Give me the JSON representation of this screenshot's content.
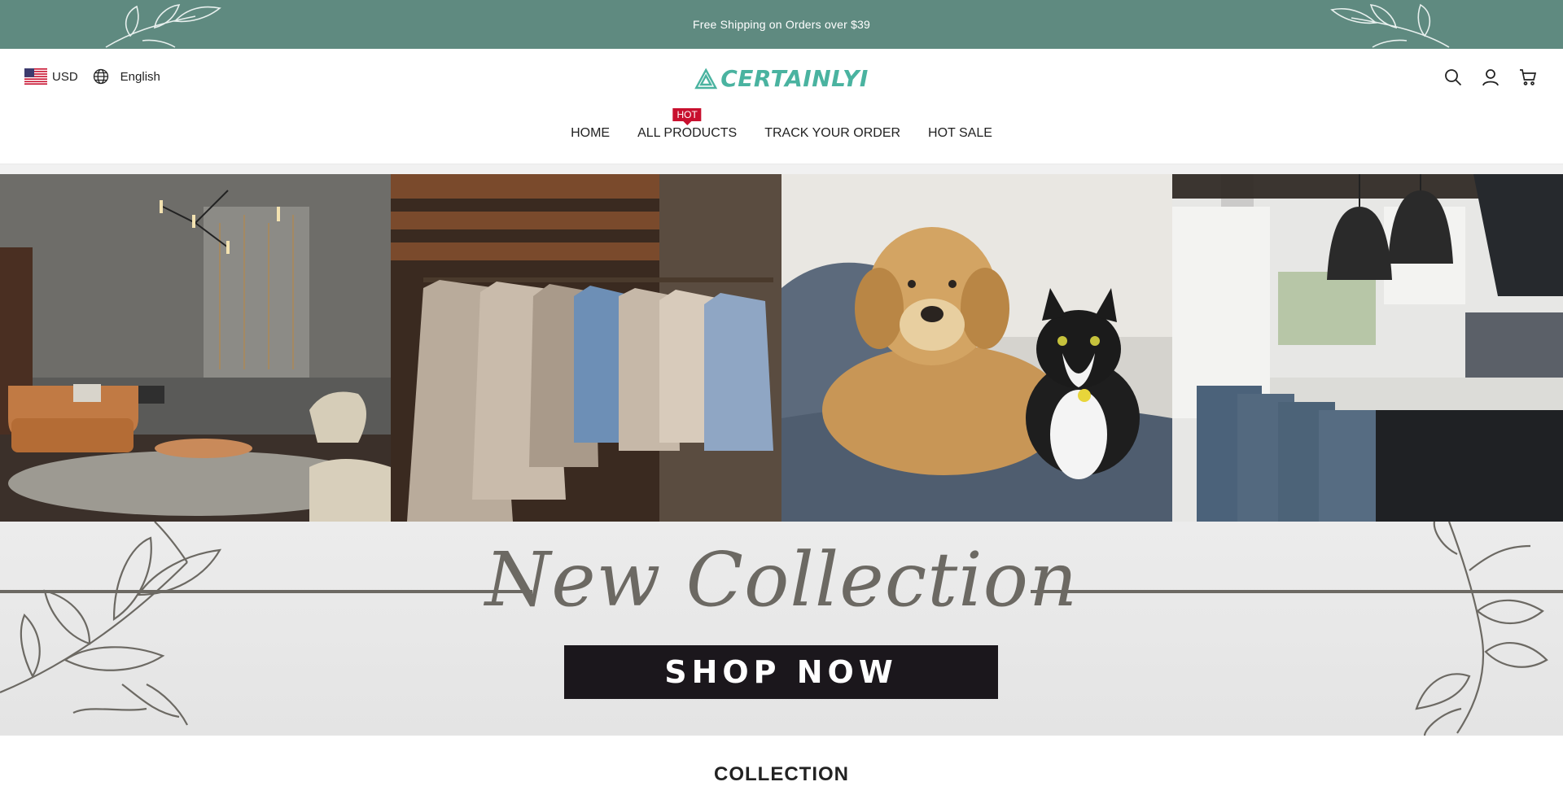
{
  "announcement": {
    "text": "Free Shipping on Orders over $39"
  },
  "header": {
    "currency": "USD",
    "language": "English",
    "logo_text": "CERTAINLYI"
  },
  "nav": {
    "items": [
      {
        "label": "HOME"
      },
      {
        "label": "ALL PRODUCTS",
        "badge": "HOT"
      },
      {
        "label": "TRACK YOUR ORDER"
      },
      {
        "label": "HOT SALE"
      }
    ]
  },
  "hero": {
    "title": "New Collection",
    "cta": "SHOP NOW"
  },
  "section": {
    "title": "COLLECTION"
  },
  "colors": {
    "announce_bg": "#5f8a80",
    "brand": "#4ab3a0",
    "badge": "#c8102e",
    "cta_bg": "#1b171c",
    "script": "#6c6963"
  }
}
